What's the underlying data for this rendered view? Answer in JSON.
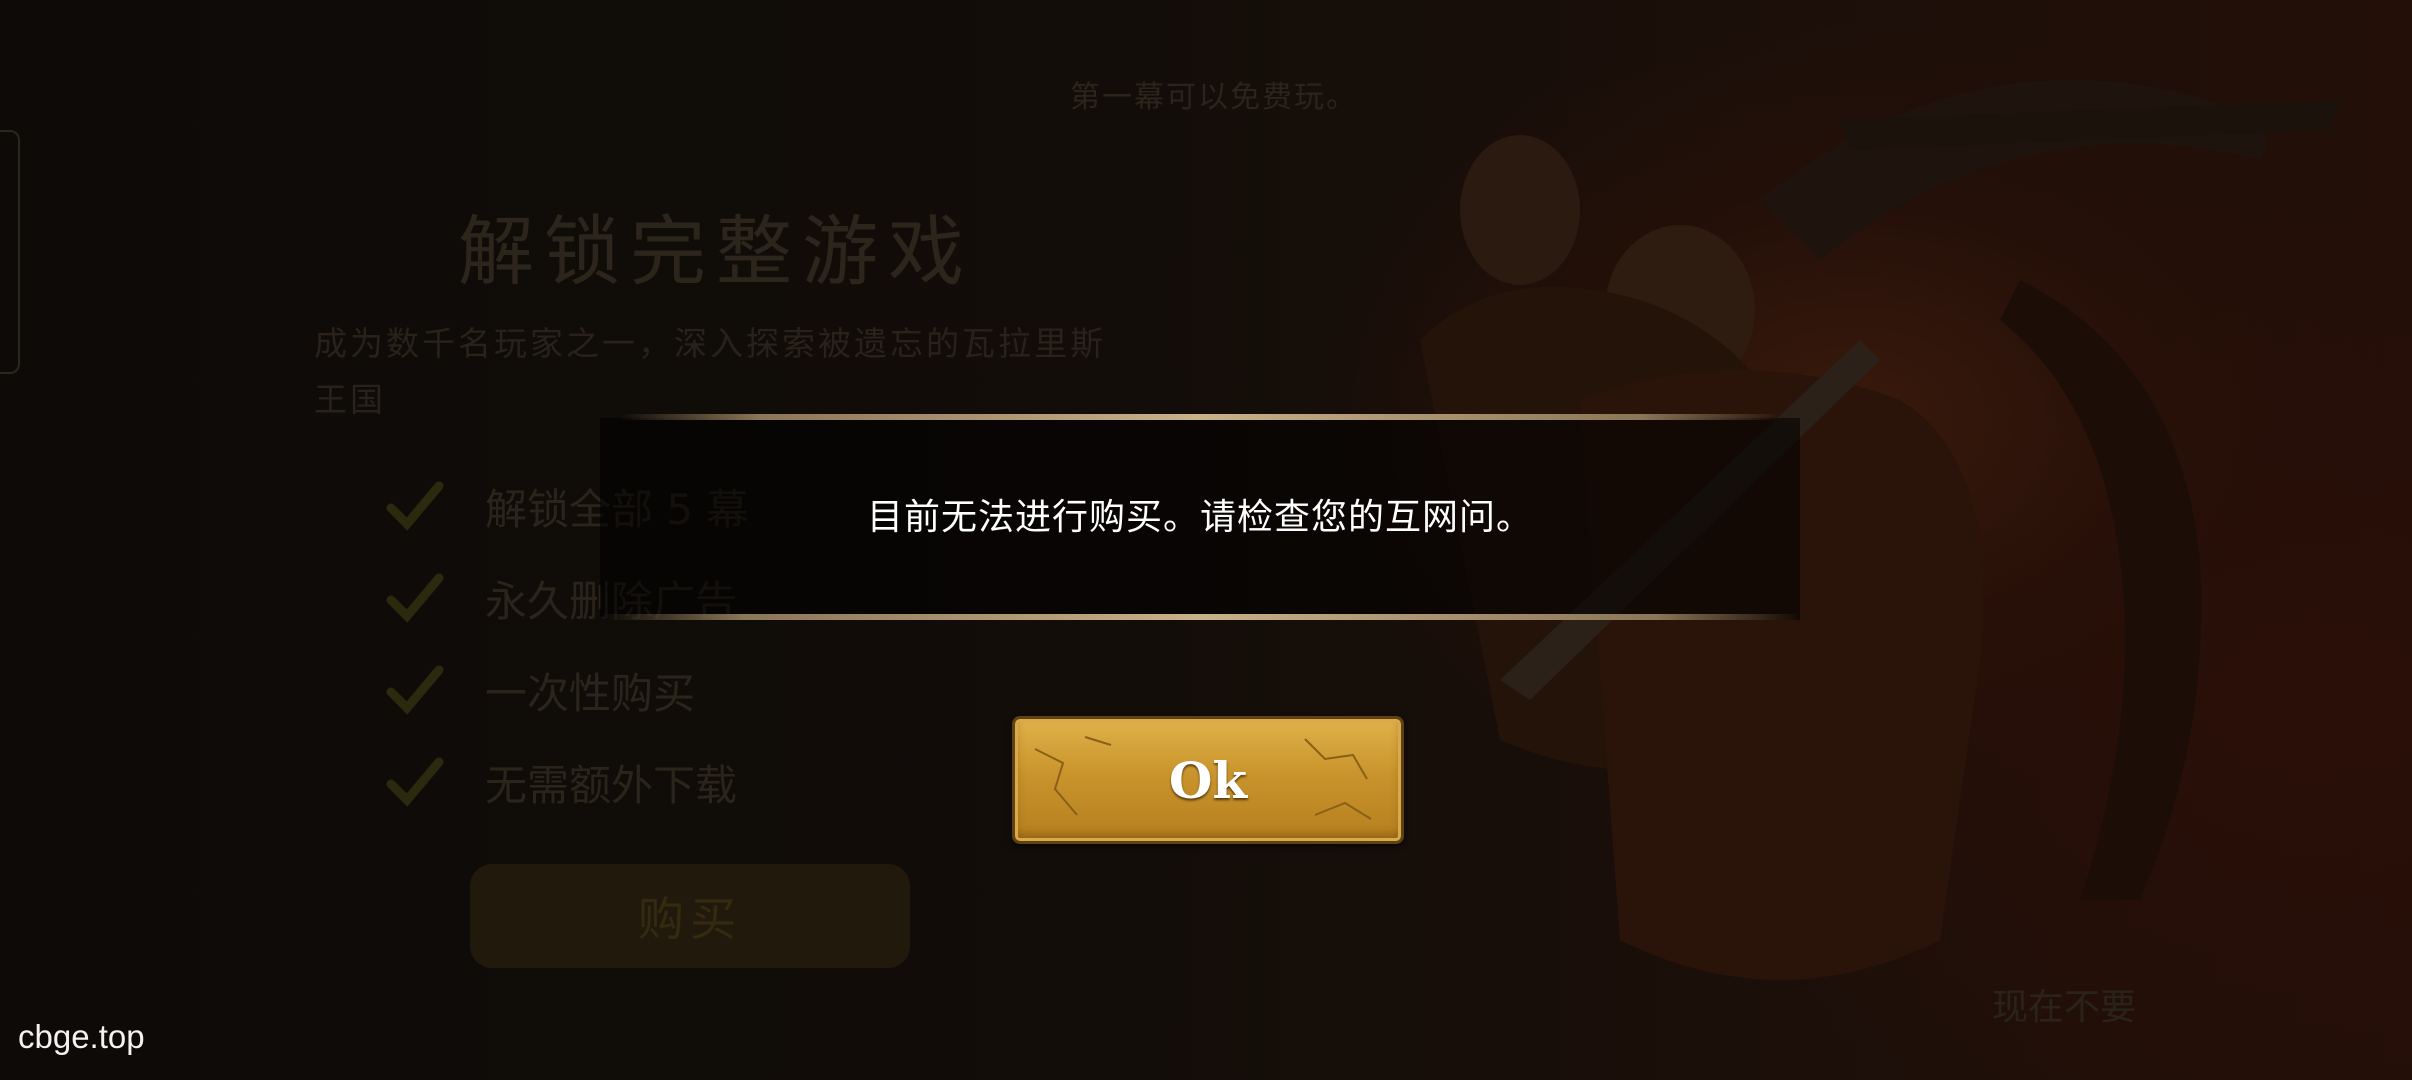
{
  "background_store": {
    "subtitle": "第一幕可以免费玩。",
    "title": "解锁完整游戏",
    "description": "成为数千名玩家之一，深入探索被遗忘的瓦拉里斯王国",
    "features": [
      {
        "label": "解锁全部 5 幕",
        "icon": "check-icon"
      },
      {
        "label": "永久删除广告",
        "icon": "check-icon"
      },
      {
        "label": "一次性购买",
        "icon": "check-icon"
      },
      {
        "label": "无需额外下载",
        "icon": "check-icon"
      }
    ],
    "buy_label": "购买",
    "not_now_label": "现在不要"
  },
  "modal": {
    "message": "目前无法进行购买。请检查您的互网问。",
    "ok_label": "Ok"
  },
  "watermark": "cbge.top",
  "colors": {
    "button_gold": "#c9942c",
    "band_line": "#c9b188",
    "message_text": "#ffffff"
  }
}
